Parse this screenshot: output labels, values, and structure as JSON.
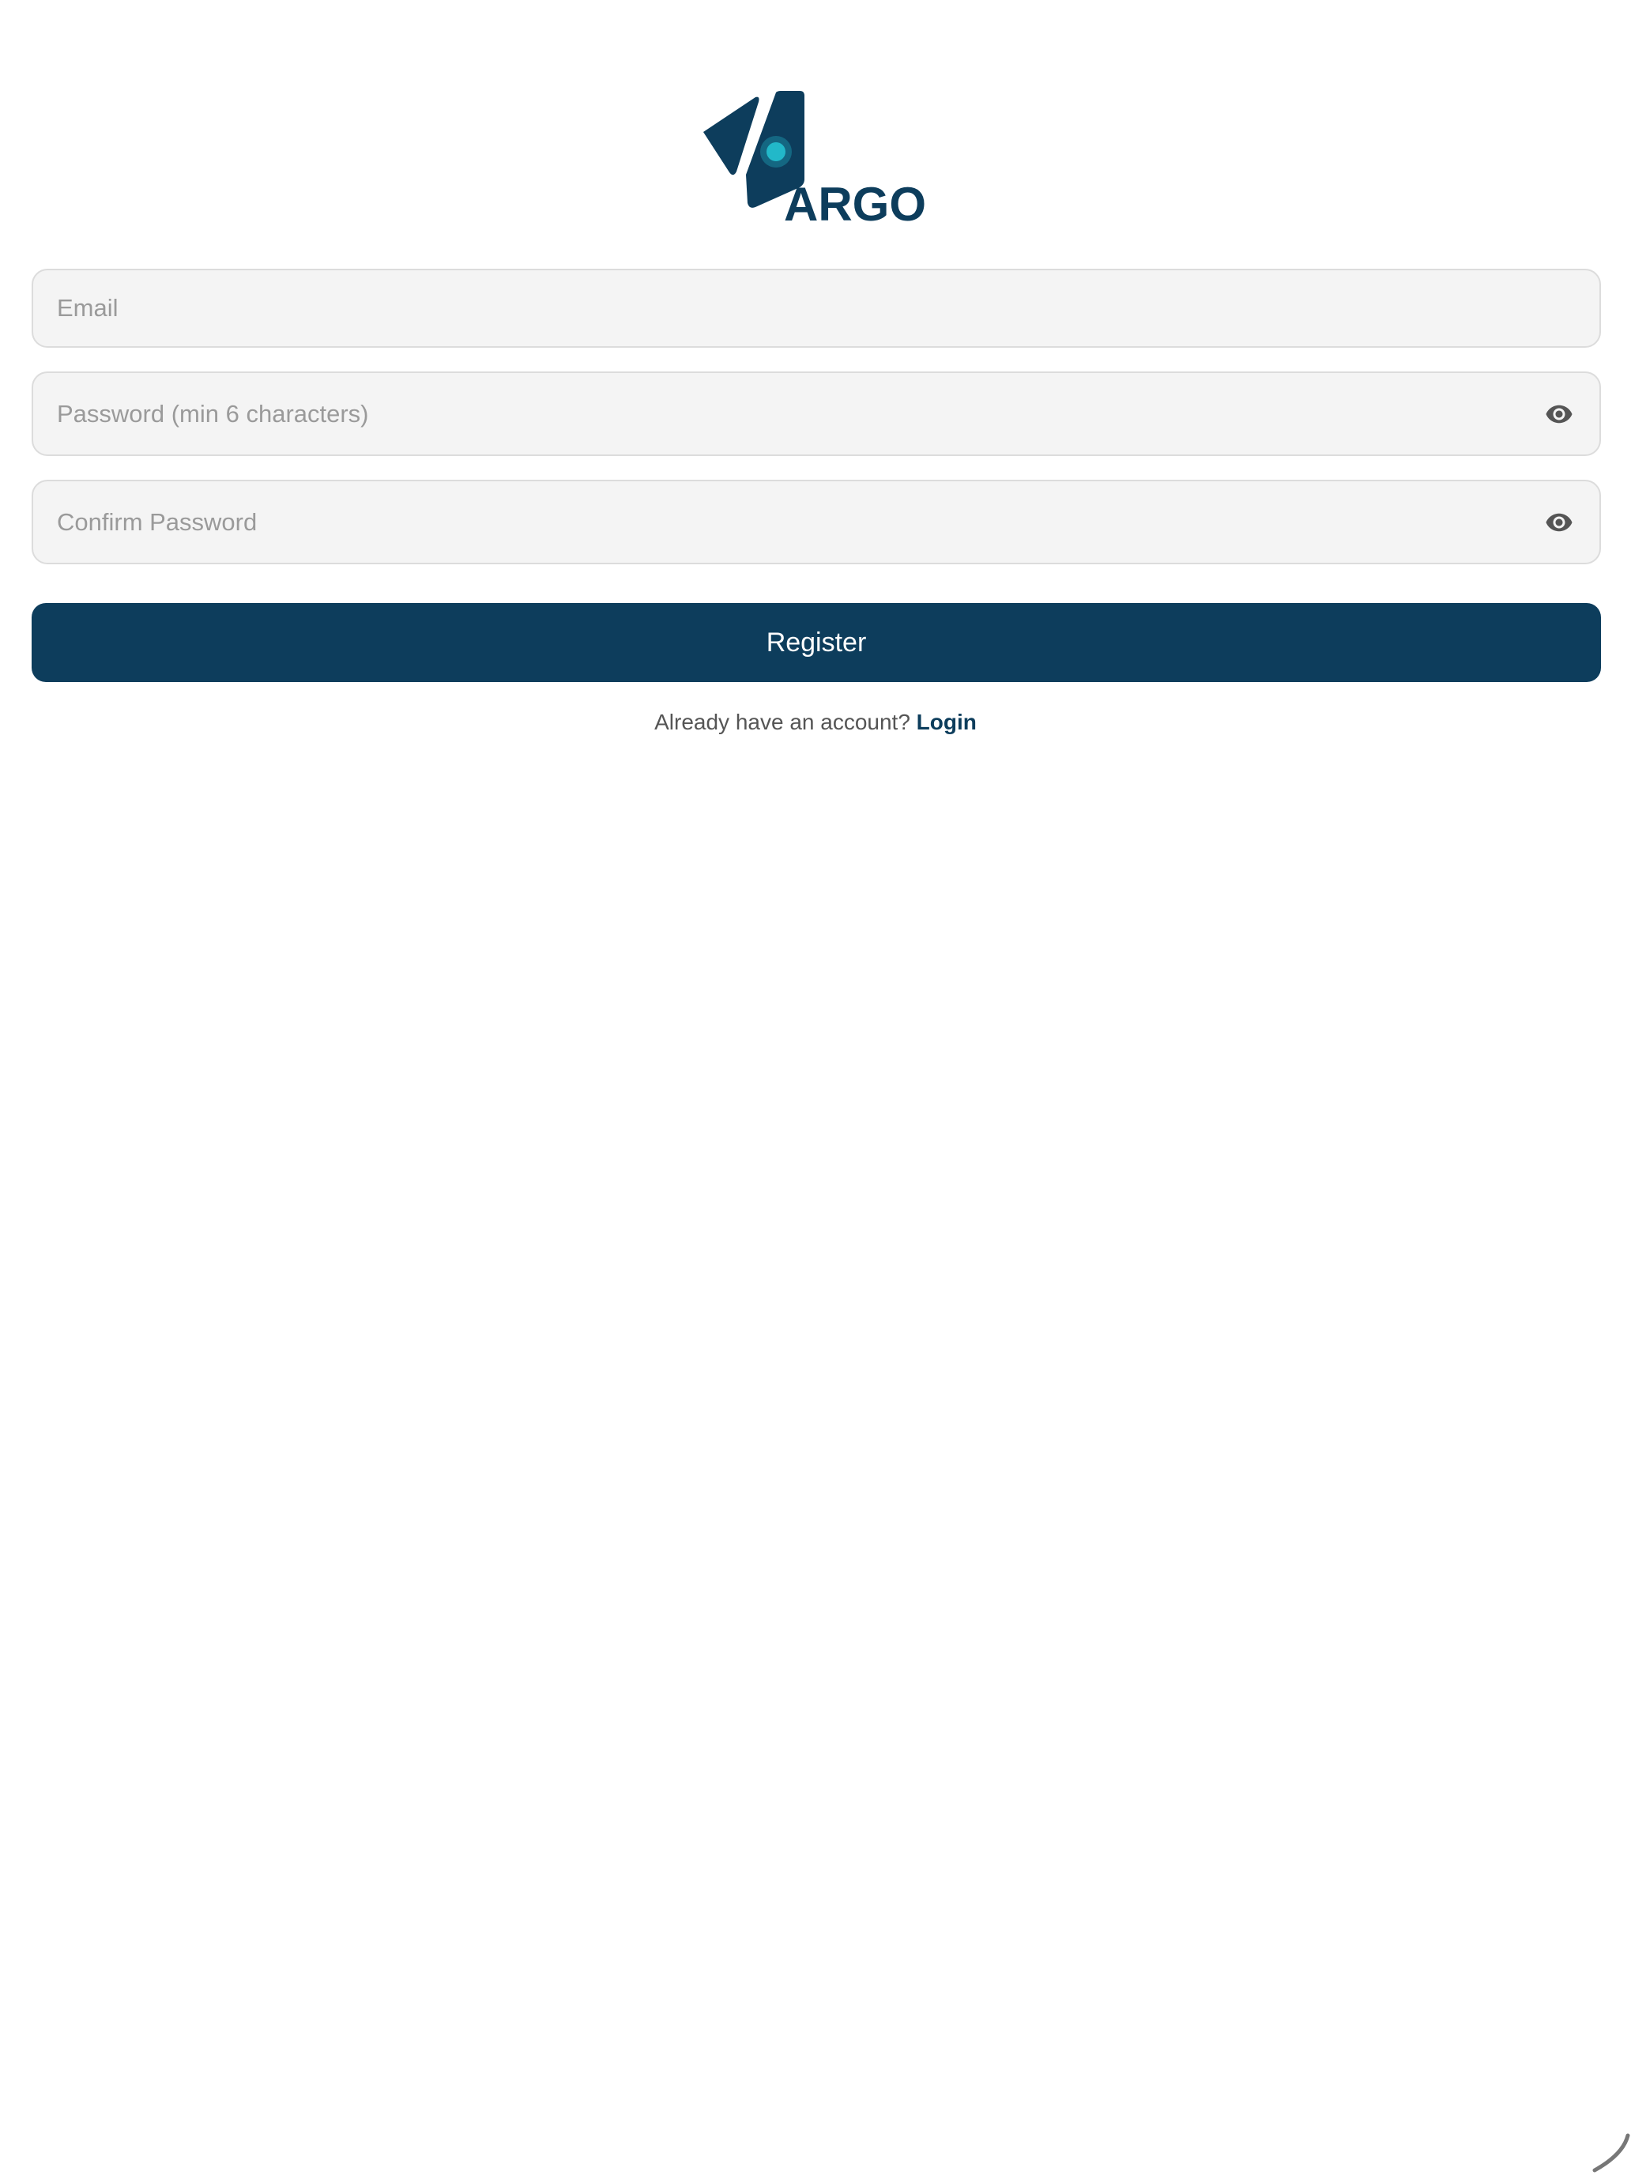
{
  "app": {
    "logo_text": "ARGO",
    "brand_color": "#0d3d5c",
    "accent_color": "#22b8c9"
  },
  "form": {
    "email_placeholder": "Email",
    "password_placeholder": "Password (min 6 characters)",
    "confirm_placeholder": "Confirm Password",
    "password_icon": "eye-icon",
    "confirm_icon": "eye-icon",
    "register_label": "Register"
  },
  "footer": {
    "prompt": "Already have an account?",
    "login_label": "Login"
  },
  "status": {
    "loading_icon": "spinner-icon"
  }
}
